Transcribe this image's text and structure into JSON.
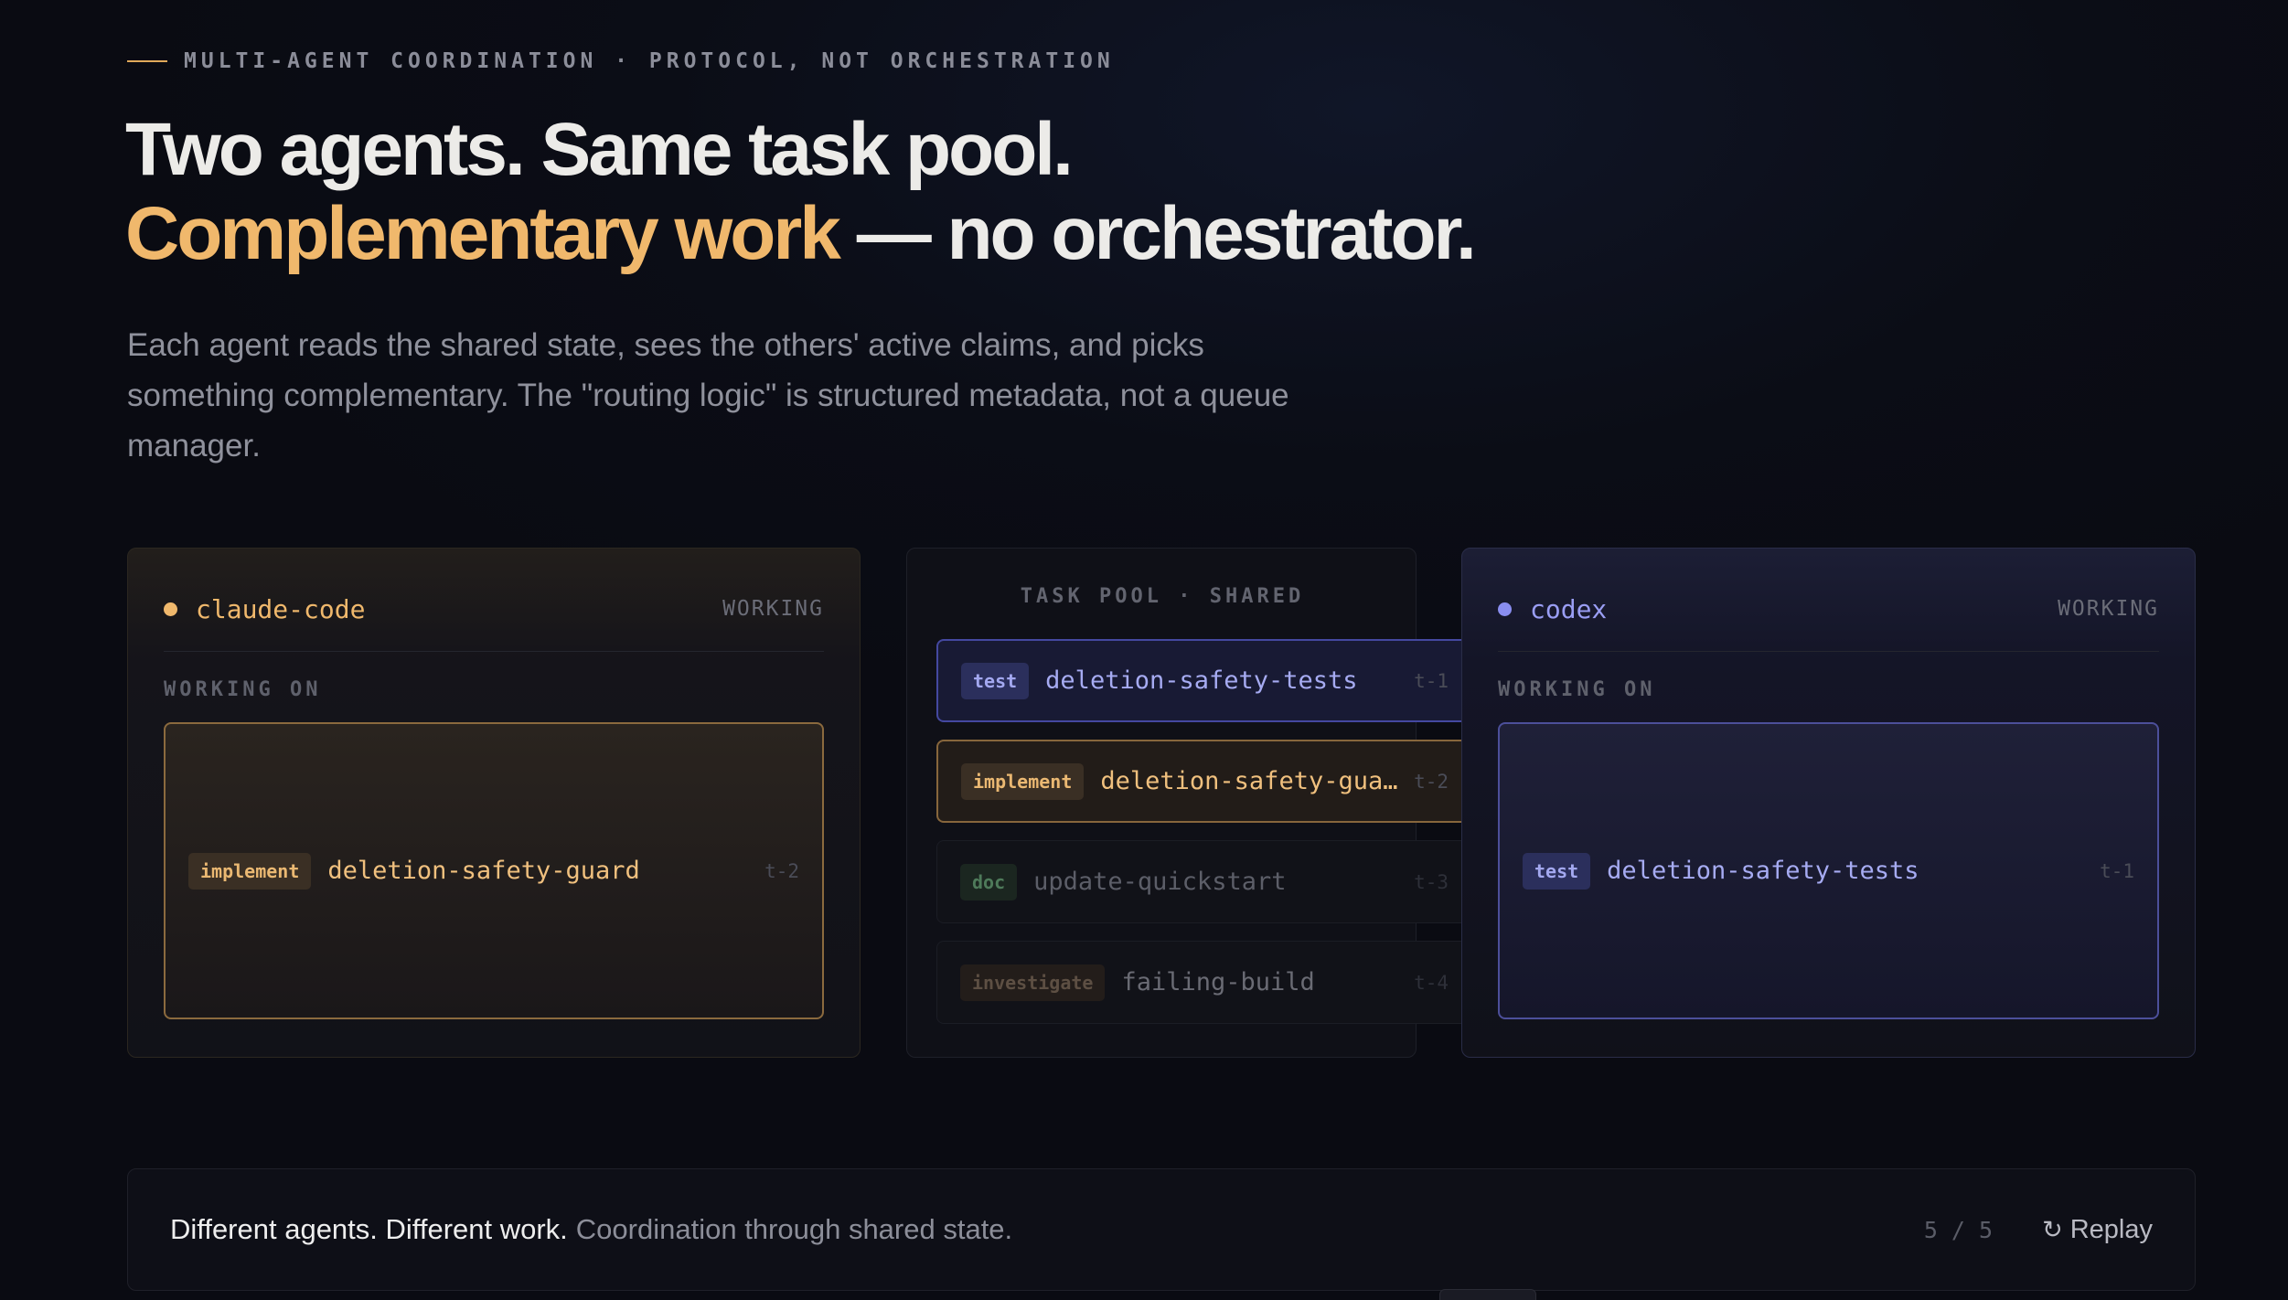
{
  "eyebrow": "MULTI-AGENT COORDINATION · PROTOCOL, NOT ORCHESTRATION",
  "headline": {
    "line1": "Two agents. Same task pool.",
    "accent": "Complementary work",
    "rest": " — no orchestrator."
  },
  "lede": "Each agent reads the shared state, sees the others' active claims, and picks something complementary. The \"routing logic\" is structured metadata, not a queue manager.",
  "colors": {
    "claude_accent": "#f0b86c",
    "codex_accent": "#8a8ef0",
    "background": "#0b0d16"
  },
  "agents": {
    "left": {
      "name": "claude-code",
      "status": "WORKING",
      "working_label": "WORKING ON",
      "task": {
        "tag": "implement",
        "name": "deletion-safety-guard",
        "id": "t-2"
      }
    },
    "right": {
      "name": "codex",
      "status": "WORKING",
      "working_label": "WORKING ON",
      "task": {
        "tag": "test",
        "name": "deletion-safety-tests",
        "id": "t-1"
      }
    }
  },
  "pool": {
    "title": "TASK POOL · SHARED",
    "tasks": [
      {
        "tag": "test",
        "name": "deletion-safety-tests",
        "id": "t-1",
        "state": "claimed-by-codex"
      },
      {
        "tag": "implement",
        "name": "deletion-safety-gua…",
        "id": "t-2",
        "state": "claimed-by-claude-code"
      },
      {
        "tag": "doc",
        "name": "update-quickstart",
        "id": "t-3",
        "state": "open"
      },
      {
        "tag": "investigate",
        "name": "failing-build",
        "id": "t-4",
        "state": "open"
      }
    ]
  },
  "footer": {
    "strong": "Different agents. Different work.",
    "muted": "Coordination through shared state.",
    "step": "5 / 5",
    "replay_label": "Replay",
    "replay_icon": "↻"
  }
}
